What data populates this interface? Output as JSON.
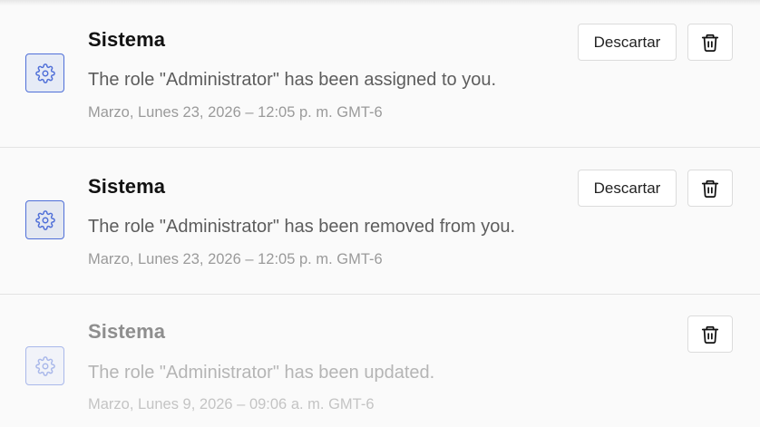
{
  "notifications": [
    {
      "sender": "Sistema",
      "message": "The role \"Administrator\" has been assigned to you.",
      "timestamp": "Marzo, Lunes 23, 2026 – 12:05 p. m. GMT-6",
      "dismiss_label": "Descartar",
      "read": false
    },
    {
      "sender": "Sistema",
      "message": "The role \"Administrator\" has been removed from you.",
      "timestamp": "Marzo, Lunes 23, 2026 – 12:05 p. m. GMT-6",
      "dismiss_label": "Descartar",
      "read": false
    },
    {
      "sender": "Sistema",
      "message": "The role \"Administrator\" has been updated.",
      "timestamp": "Marzo, Lunes 9, 2026 – 09:06 a. m. GMT-6",
      "read": true
    }
  ],
  "icons": {
    "sender": "gear-icon",
    "delete": "trash-icon"
  },
  "colors": {
    "accent": "#4f6fd8",
    "read_accent": "#a9b8ea",
    "title": "#111111",
    "read_title": "#8e8e8e",
    "message": "#5d5d5d",
    "read_message": "#b5b5b5",
    "timestamp": "#9a9a9a",
    "read_timestamp": "#c4c4c4"
  }
}
